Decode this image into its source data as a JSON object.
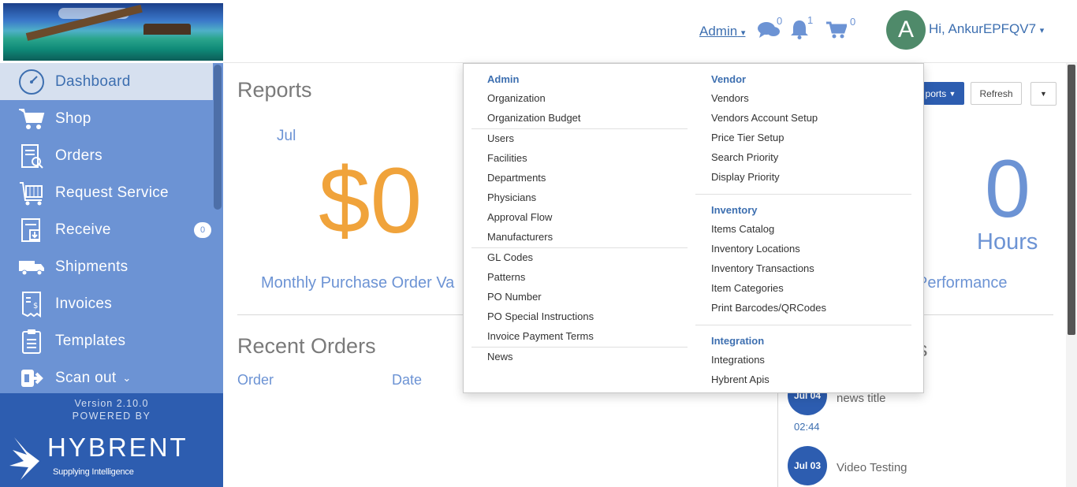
{
  "header": {
    "admin_label": "Admin",
    "messages_count": "0",
    "notifications_count": "1",
    "cart_count": "0",
    "avatar_initial": "A",
    "greeting": "Hi, AnkurEPFQV7"
  },
  "sidebar": {
    "items": [
      {
        "label": "Dashboard",
        "icon": "dashboard-icon"
      },
      {
        "label": "Shop",
        "icon": "cart-icon"
      },
      {
        "label": "Orders",
        "icon": "orders-icon"
      },
      {
        "label": "Request Service",
        "icon": "request-service-icon"
      },
      {
        "label": "Receive",
        "icon": "receive-icon",
        "badge": "0"
      },
      {
        "label": "Shipments",
        "icon": "truck-icon"
      },
      {
        "label": "Invoices",
        "icon": "invoice-icon"
      },
      {
        "label": "Templates",
        "icon": "template-icon"
      },
      {
        "label": "Scan out",
        "icon": "scan-out-icon"
      }
    ],
    "version": "Version 2.10.0",
    "powered_by": "POWERED BY",
    "brand_name": "HYBRENT",
    "brand_tagline": "Supplying Intelligence"
  },
  "main": {
    "title": "Reports",
    "month": "Jul",
    "amount": "$0",
    "metric_label": "Monthly Purchase Order Va",
    "performance_label": "Performance",
    "hours_value": "0",
    "hours_label": "Hours",
    "reports_btn": "ports",
    "refresh_btn": "Refresh",
    "recent_orders_title": "Recent Orders",
    "columns": [
      "Order",
      "Date"
    ],
    "news_section_partial": "s",
    "news": [
      {
        "date": "Jul 04",
        "time": "02:44",
        "title": "news title"
      },
      {
        "date": "Jul 03",
        "title": "Video Testing"
      }
    ]
  },
  "admin_menu": {
    "admin_heading": "Admin",
    "admin_group1": [
      "Organization",
      "Organization Budget"
    ],
    "admin_group2": [
      "Users",
      "Facilities",
      "Departments",
      "Physicians",
      "Approval Flow",
      "Manufacturers"
    ],
    "admin_group3": [
      "GL Codes",
      "Patterns",
      "PO Number",
      "PO Special Instructions",
      "Invoice Payment Terms"
    ],
    "admin_group4": [
      "News"
    ],
    "vendor_heading": "Vendor",
    "vendor_items": [
      "Vendors",
      "Vendors Account Setup",
      "Price Tier Setup",
      "Search Priority",
      "Display Priority"
    ],
    "inventory_heading": "Inventory",
    "inventory_items": [
      "Items Catalog",
      "Inventory Locations",
      "Inventory Transactions",
      "Item Categories",
      "Print Barcodes/QRCodes"
    ],
    "integration_heading": "Integration",
    "integration_items": [
      "Integrations",
      "Hybrent Apis"
    ]
  }
}
